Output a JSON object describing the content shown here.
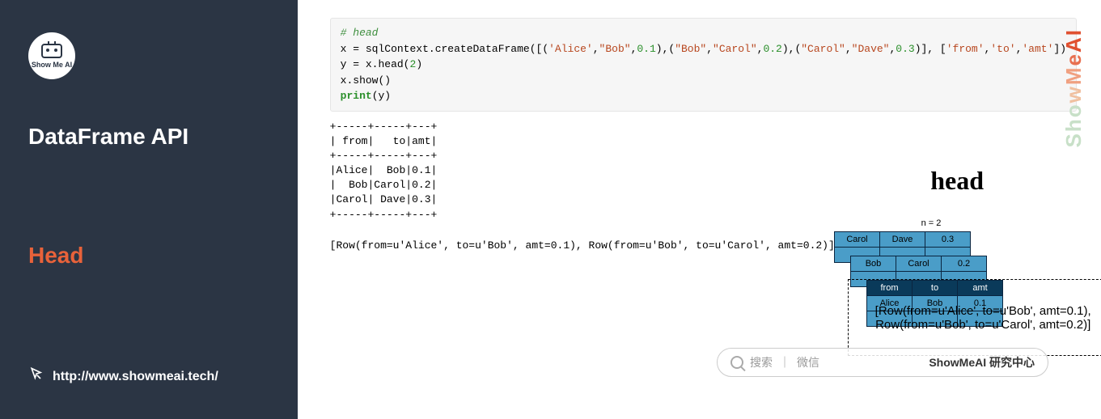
{
  "sidebar": {
    "logo_text": "Show Me AI",
    "title": "DataFrame API",
    "subtitle": "Head",
    "url": "http://www.showmeai.tech/"
  },
  "code": {
    "comment": "# head",
    "line1_a": "x = sqlContext.createDataFrame([(",
    "str1": "'Alice'",
    "sep1": ",",
    "str2": "\"Bob\"",
    "sep2": ",",
    "num1": "0.1",
    "sep3": "),(",
    "str3": "\"Bob\"",
    "sep4": ",",
    "str4": "\"Carol\"",
    "sep5": ",",
    "num2": "0.2",
    "sep6": "),(",
    "str5": "\"Carol\"",
    "sep7": ",",
    "str6": "\"Dave\"",
    "sep8": ",",
    "num3": "0.3",
    "sep9": ")], [",
    "str7": "'from'",
    "sep10": ",",
    "str8": "'to'",
    "sep11": ",",
    "str9": "'amt'",
    "line1_z": "])",
    "line2_a": "y = x.head(",
    "line2_n": "2",
    "line2_z": ")",
    "line3": "x.show()",
    "line4_kw": "print",
    "line4_rest": "(y)"
  },
  "output": {
    "table": "+-----+-----+---+\n| from|   to|amt|\n+-----+-----+---+\n|Alice|  Bob|0.1|\n|  Bob|Carol|0.2|\n|Carol| Dave|0.3|\n+-----+-----+---+",
    "rows": "[Row(from=u'Alice', to=u'Bob', amt=0.1), Row(from=u'Bob', to=u'Carol', amt=0.2)]"
  },
  "diagram": {
    "head_label": "head",
    "n_label": "n = 2",
    "headers": {
      "from": "from",
      "to": "to",
      "amt": "amt"
    },
    "r1": {
      "c1": "Carol",
      "c2": "Dave",
      "c3": "0.3"
    },
    "r2": {
      "c1": "Bob",
      "c2": "Carol",
      "c3": "0.2"
    },
    "r3": {
      "c1": "Alice",
      "c2": "Bob",
      "c3": "0.1"
    },
    "dashed": "[Row(from=u'Alice', to=u'Bob', amt=0.1),\nRow(from=u'Bob', to=u'Carol', amt=0.2)]"
  },
  "watermark": {
    "w1": "S",
    "w2": "h",
    "w3": "o",
    "w4": "w",
    "w5": "M",
    "w6": "e",
    "w7": "A",
    "w8": "I"
  },
  "searchbar": {
    "search": "搜索",
    "sep1": " ｜ ",
    "wechat": "微信",
    "bold": "ShowMeAI 研究中心"
  }
}
